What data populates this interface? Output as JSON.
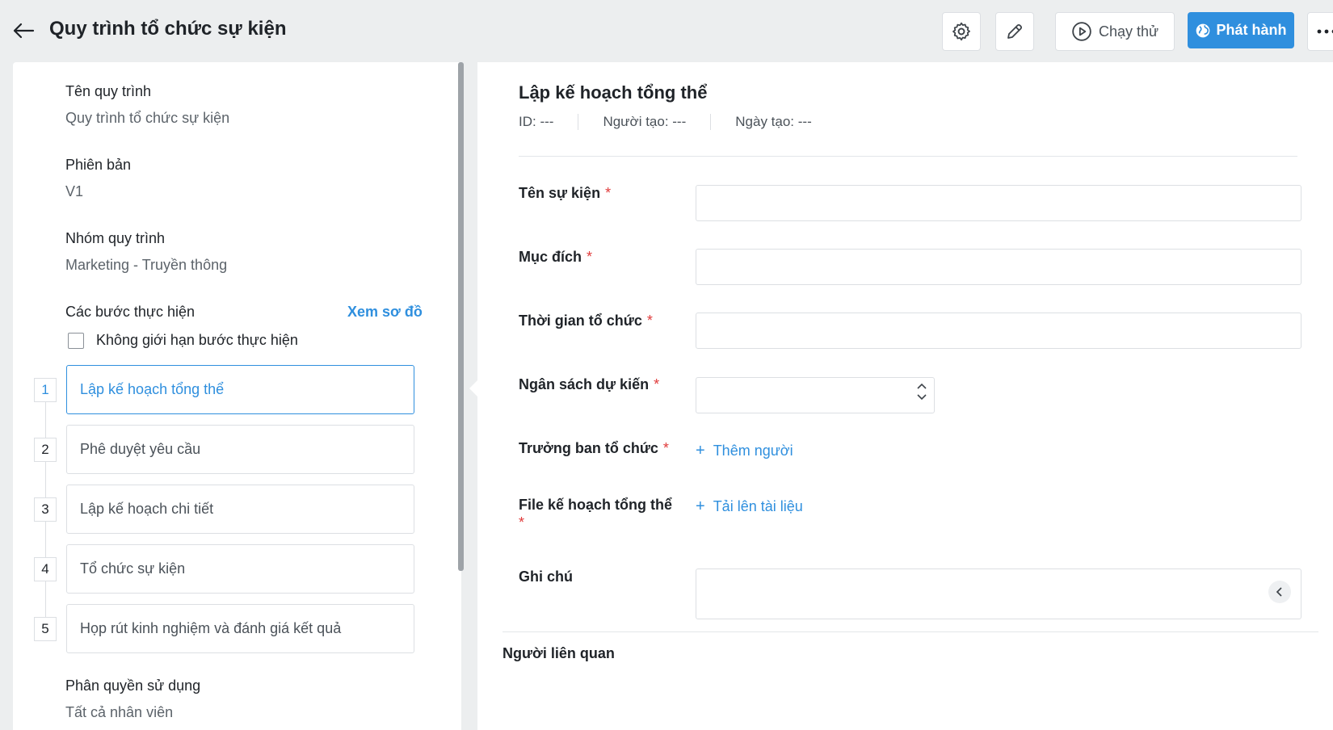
{
  "header": {
    "title": "Quy trình tổ chức sự kiện",
    "run_label": "Chạy thử",
    "publish_label": "Phát hành"
  },
  "left": {
    "process_name_label": "Tên quy trình",
    "process_name_value": "Quy trình tổ chức sự kiện",
    "version_label": "Phiên bản",
    "version_value": "V1",
    "group_label": "Nhóm quy trình",
    "group_value": "Marketing - Truyền thông",
    "steps_label": "Các bước thực hiện",
    "view_diagram": "Xem sơ đồ",
    "unlimited_label": "Không giới hạn bước thực hiện",
    "steps": [
      {
        "num": "1",
        "label": "Lập kế hoạch tổng thể"
      },
      {
        "num": "2",
        "label": "Phê duyệt yêu cầu"
      },
      {
        "num": "3",
        "label": "Lập kế hoạch chi tiết"
      },
      {
        "num": "4",
        "label": "Tổ chức sự kiện"
      },
      {
        "num": "5",
        "label": "Họp rút kinh nghiệm và đánh giá kết quả"
      }
    ],
    "permission_label": "Phân quyền sử dụng",
    "permission_value": "Tất cả nhân viên"
  },
  "form": {
    "title": "Lập kế hoạch tổng thể",
    "meta": {
      "id": "ID:  ---",
      "creator": "Người tạo:  ---",
      "created": "Ngày tạo:  ---"
    },
    "fields": {
      "event_name": "Tên sự kiện",
      "purpose": "Mục đích",
      "time": "Thời gian tổ chức",
      "budget": "Ngân sách dự kiến",
      "head": "Trưởng ban tổ chức",
      "file_line1": "File kế hoạch tổng thể",
      "note": "Ghi chú"
    },
    "required_mark": "*",
    "add_person": "Thêm người",
    "upload_doc": "Tải lên tài liệu",
    "related_title": "Người liên quan"
  },
  "colors": {
    "accent": "#2f8fde",
    "required": "#e03b3b"
  }
}
